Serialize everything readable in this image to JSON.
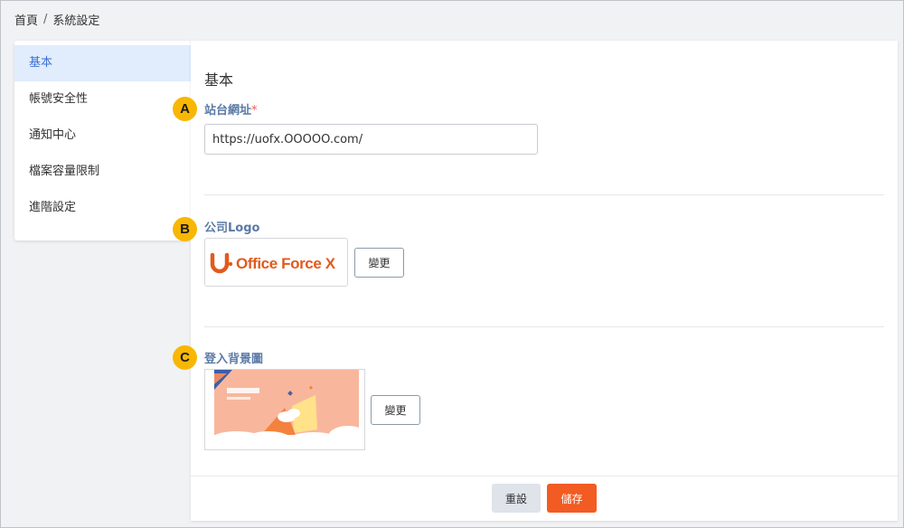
{
  "breadcrumb": {
    "home": "首頁",
    "separator": "/",
    "current": "系統設定"
  },
  "sidebar": {
    "items": [
      {
        "label": "基本",
        "active": true
      },
      {
        "label": "帳號安全性"
      },
      {
        "label": "通知中心"
      },
      {
        "label": "檔案容量限制"
      },
      {
        "label": "進階設定"
      }
    ]
  },
  "main": {
    "section_title": "基本",
    "site_url": {
      "label": "站台網址",
      "required_mark": "*",
      "value": "https://uofx.OOOOO.com/"
    },
    "company_logo": {
      "label": "公司Logo",
      "logo_text": "Office Force X",
      "change_label": "變更"
    },
    "login_background": {
      "label": "登入背景圖",
      "change_label": "變更"
    }
  },
  "footer": {
    "reset_label": "重設",
    "save_label": "儲存"
  },
  "markers": {
    "a": "A",
    "b": "B",
    "c": "C"
  },
  "colors": {
    "accent_orange": "#f25b21",
    "marker_yellow": "#f8b703",
    "label_blue": "#5b7aa6",
    "active_blue": "#3b6fd8"
  }
}
